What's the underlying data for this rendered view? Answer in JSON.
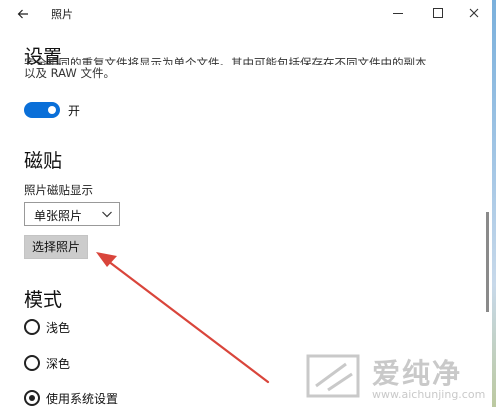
{
  "window": {
    "title": "照片",
    "back_icon": "arrow-left-icon",
    "minimize_icon": "minimize-icon",
    "maximize_icon": "maximize-icon",
    "close_icon": "close-icon"
  },
  "settings": {
    "page_title": "设置",
    "raw_note_line1": "完全相同的重复文件将显示为单个文件。其中可能包括保存在不同文件中的副本",
    "raw_note_line2": "以及 RAW 文件。",
    "toggle": {
      "state_label": "开",
      "on": true,
      "accent": "#0a6fd8"
    }
  },
  "tiles": {
    "title": "磁贴",
    "field_label": "照片磁贴显示",
    "select_value": "单张照片",
    "choose_button": "选择照片"
  },
  "mode": {
    "title": "模式",
    "options": [
      {
        "label": "浅色",
        "checked": false
      },
      {
        "label": "深色",
        "checked": false
      },
      {
        "label": "使用系统设置",
        "checked": true
      }
    ]
  },
  "annotation": {
    "arrow_color": "#d9453b"
  },
  "watermark": {
    "text": "爱纯净",
    "url": "www.aichunjing.com"
  }
}
